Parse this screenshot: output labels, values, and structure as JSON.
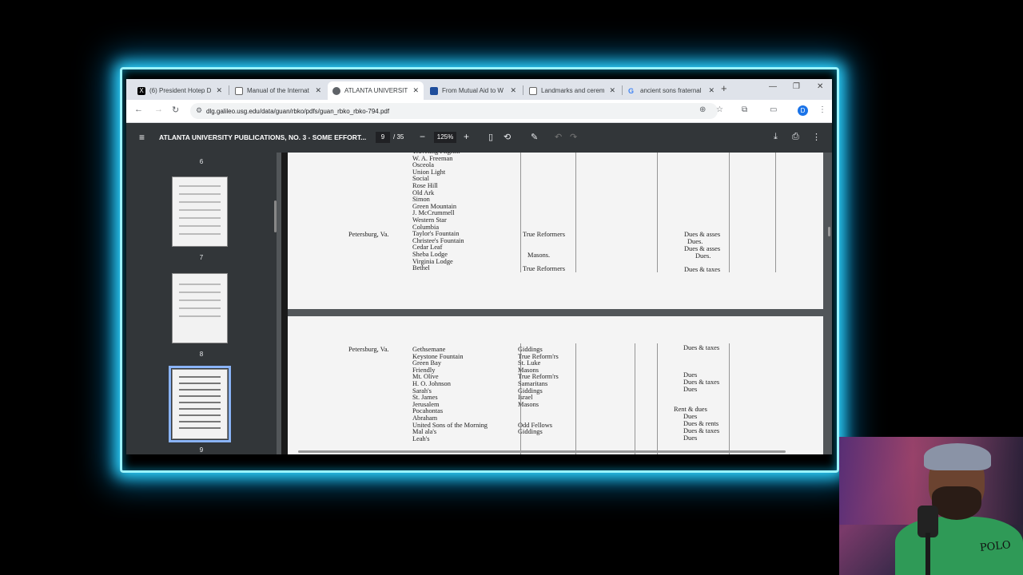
{
  "browser": {
    "tabs": [
      {
        "title": "(6) President Hotep D",
        "icon": "x-logo-icon",
        "active": false
      },
      {
        "title": "Manual of the Internat",
        "icon": "document-icon",
        "active": false
      },
      {
        "title": "ATLANTA UNIVERSITY",
        "icon": "tab-audio-icon",
        "active": true
      },
      {
        "title": "From Mutual Aid to W",
        "icon": "journal-icon",
        "active": false
      },
      {
        "title": "Landmarks and cerem",
        "icon": "document-icon",
        "active": false
      },
      {
        "title": "ancient sons fraternal",
        "icon": "google-icon",
        "active": false
      }
    ],
    "url": "dlg.galileo.usg.edu/data/guan/rbko/pdfs/guan_rbko_rbko-794.pdf",
    "profile_initial": "D"
  },
  "pdf": {
    "title": "ATLANTA UNIVERSITY PUBLICATIONS, NO. 3 - SOME EFFORT...",
    "current_page": "9",
    "total_pages": "/ 35",
    "zoom": "125%"
  },
  "sidebar": {
    "thumbnails": [
      {
        "label": "6",
        "selected": false
      },
      {
        "label": "7",
        "selected": false
      },
      {
        "label": "8",
        "selected": false
      },
      {
        "label": "9",
        "selected": true
      }
    ]
  },
  "document": {
    "page_a_rows": [
      "Traveling Pilgrim",
      "W. A. Freeman",
      "Osceola",
      "Union Light",
      "Social",
      "Rose Hill",
      "Old Ark",
      "Simon",
      "Green Mountain",
      "J. McCrummell",
      "Western Star",
      "Columbia",
      "Taylor's Fountain",
      "Christee's Fountain",
      "Cedar Leaf",
      "Sheba Lodge",
      "Virginia Lodge",
      "Bethel"
    ],
    "page_a_place": "Petersburg, Va.",
    "page_a_orders": [
      "True Reformers",
      "Masons.",
      "True Reformers"
    ],
    "page_a_notes": [
      "Dues & asses",
      "Dues.",
      "Dues & asses",
      "Dues.",
      "Dues & taxes"
    ],
    "page_b_place": "Petersburg, Va.",
    "page_b_rows": [
      {
        "name": "Gethsemane",
        "order": "Giddings"
      },
      {
        "name": "Keystone Fountain",
        "order": "True Reform'rs"
      },
      {
        "name": "Green Bay",
        "order": "St. Luke"
      },
      {
        "name": "Friendly",
        "order": "Masons"
      },
      {
        "name": "Mt. Olive",
        "order": "True Reform'rs"
      },
      {
        "name": "H. O. Johnson",
        "order": "Samaritans"
      },
      {
        "name": "Sarah's",
        "order": "Giddings"
      },
      {
        "name": "St. James",
        "order": "Israel"
      },
      {
        "name": "Jerusalem",
        "order": "Masons"
      },
      {
        "name": "Pocahontas",
        "order": ""
      },
      {
        "name": "Abraham",
        "order": ""
      },
      {
        "name": "United Sons of the Morning",
        "order": "Odd Fellows"
      },
      {
        "name": "Mal ala's",
        "order": "Giddings"
      },
      {
        "name": "Leah's",
        "order": ""
      }
    ],
    "page_b_notes": [
      "Dues & taxes",
      "Dues",
      "Dues & taxes",
      "Dues",
      "Rent & dues",
      "Dues",
      "Dues & rents",
      "Dues & taxes",
      "Dues"
    ]
  },
  "webcam": {
    "shirt_text": "POLO"
  },
  "colors": {
    "glow": "#2fd6ff",
    "pdf_toolbar": "#323639",
    "viewer_bg": "#525659"
  }
}
